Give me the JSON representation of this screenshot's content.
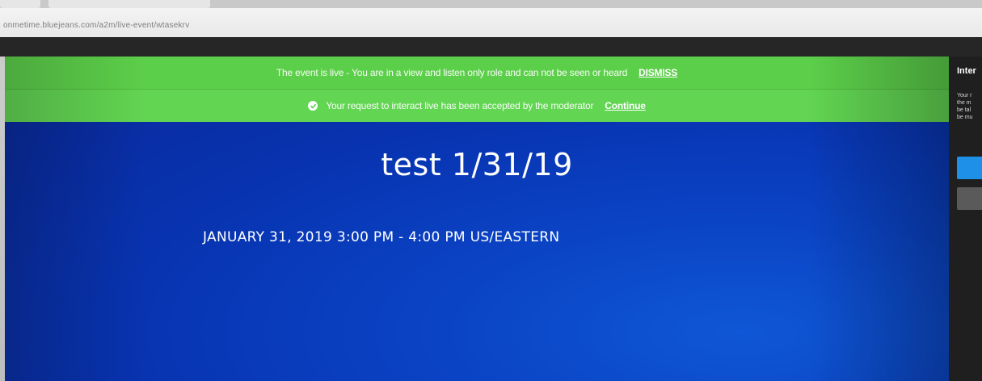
{
  "browser": {
    "url": "onmetime.bluejeans.com/a2m/live-event/wtasekrv"
  },
  "banners": {
    "live_notice": {
      "message": "The event is live - You are in a view and listen only role and can not be seen or heard",
      "action_label": "DISMISS"
    },
    "request_notice": {
      "message": "Your request to interact live has been accepted by the moderator",
      "action_label": "Continue"
    }
  },
  "event": {
    "title": "test 1/31/19",
    "datetime": "JANUARY 31, 2019 3:00 PM - 4:00 PM US/EASTERN"
  },
  "side_panel": {
    "title": "Inter",
    "text_lines": [
      "Your r",
      "the m",
      "be tal",
      "be mu"
    ]
  },
  "colors": {
    "banner_green": "#5ccf4a",
    "stage_blue": "#0a43c4",
    "panel_dark": "#1f1f1f",
    "primary_button": "#1e90e8"
  }
}
